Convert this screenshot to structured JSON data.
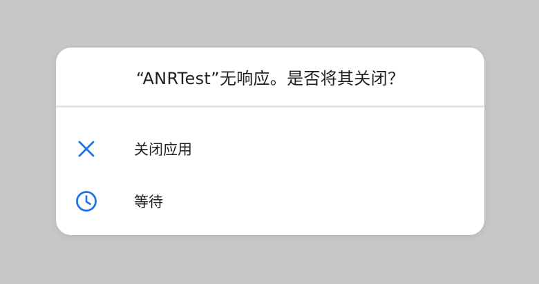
{
  "dialog": {
    "title": "“ANRTest”无响应。是否将其关闭？",
    "options": [
      {
        "label": "关闭应用",
        "icon": "close-icon"
      },
      {
        "label": "等待",
        "icon": "clock-icon"
      }
    ]
  },
  "colors": {
    "accent": "#1a73e8",
    "scrim": "#c7c7c7",
    "surface": "#ffffff",
    "text": "#1f1f1f",
    "divider": "#e4e4e4"
  }
}
